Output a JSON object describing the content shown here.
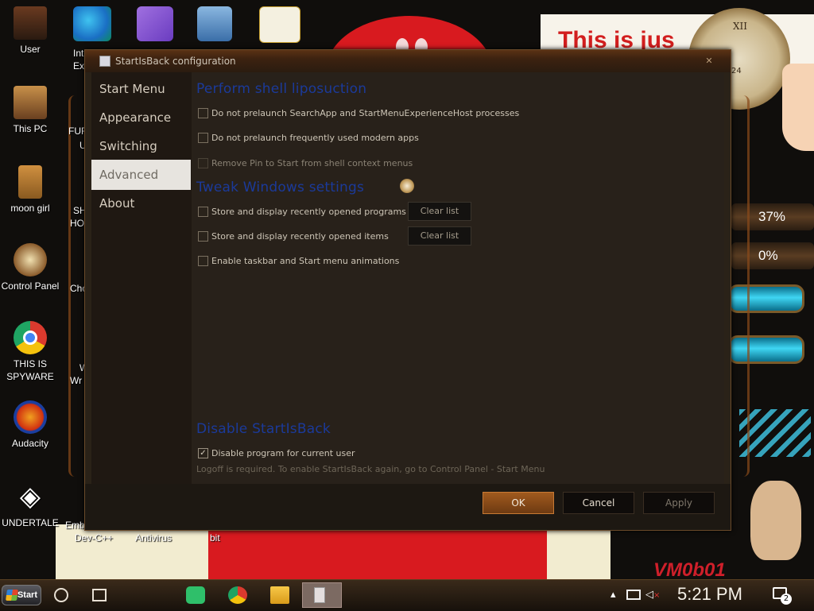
{
  "wallpaper": {
    "banner_text": "This is jus",
    "clock_numeral": "XII",
    "clock_sub": "24",
    "gauge_1": "37%",
    "gauge_2": "0%",
    "watermark": "VM0b01"
  },
  "desktop_icons": [
    {
      "label": "User",
      "icon": "user-folder-icon"
    },
    {
      "label": "This PC",
      "icon": "this-pc-icon"
    },
    {
      "label": "moon girl",
      "icon": "moon-girl-icon"
    },
    {
      "label": "Control Panel",
      "icon": "control-panel-icon"
    },
    {
      "label": "THIS IS SPYWARE",
      "icon": "chrome-icon"
    },
    {
      "label": "Audacity",
      "icon": "audacity-icon"
    },
    {
      "label": "UNDERTALE",
      "icon": "unity-icon"
    }
  ],
  "partial_labels": {
    "ie_1": "Int",
    "ie_2": "Ex",
    "fur": "FUR",
    "fur2": "U",
    "sh": "SH",
    "ho": "HO",
    "cho": "Cho",
    "w": "W",
    "wr": "Wr",
    "emb": "Emb",
    "devcpp": "Dev-C++",
    "antivirus": "Antivirus",
    "bit": "bit"
  },
  "dialog": {
    "title": "StartIsBack configuration",
    "close_label": "✕",
    "nav": [
      {
        "label": "Start Menu",
        "active": false
      },
      {
        "label": "Appearance",
        "active": false
      },
      {
        "label": "Switching",
        "active": false
      },
      {
        "label": "Advanced",
        "active": true
      },
      {
        "label": "About",
        "active": false
      }
    ],
    "section_shell": "Perform shell liposuction",
    "opt_prelaunch_search": "Do not prelaunch SearchApp and StartMenuExperienceHost processes",
    "opt_prelaunch_modern": "Do not prelaunch frequently used modern apps",
    "opt_remove_pin": "Remove Pin to Start from shell context menus",
    "section_tweak": "Tweak Windows settings",
    "opt_recent_programs": "Store and display recently opened programs",
    "opt_recent_items": "Store and display recently opened items",
    "opt_animations": "Enable taskbar and Start menu animations",
    "clear_list_label": "Clear list",
    "section_disable": "Disable StartIsBack",
    "opt_disable_program": "Disable program for current user",
    "note": "Logoff is required. To enable StartIsBack again, go to Control Panel - Start Menu",
    "ok_label": "OK",
    "cancel_label": "Cancel",
    "apply_label": "Apply"
  },
  "taskbar": {
    "start_label": "Start",
    "time": "5:21 PM",
    "notification_count": "2",
    "icons": [
      "search-circle-icon",
      "task-view-icon",
      "chat-app-icon",
      "chrome-icon",
      "file-explorer-icon",
      "startisback-config-icon"
    ]
  }
}
